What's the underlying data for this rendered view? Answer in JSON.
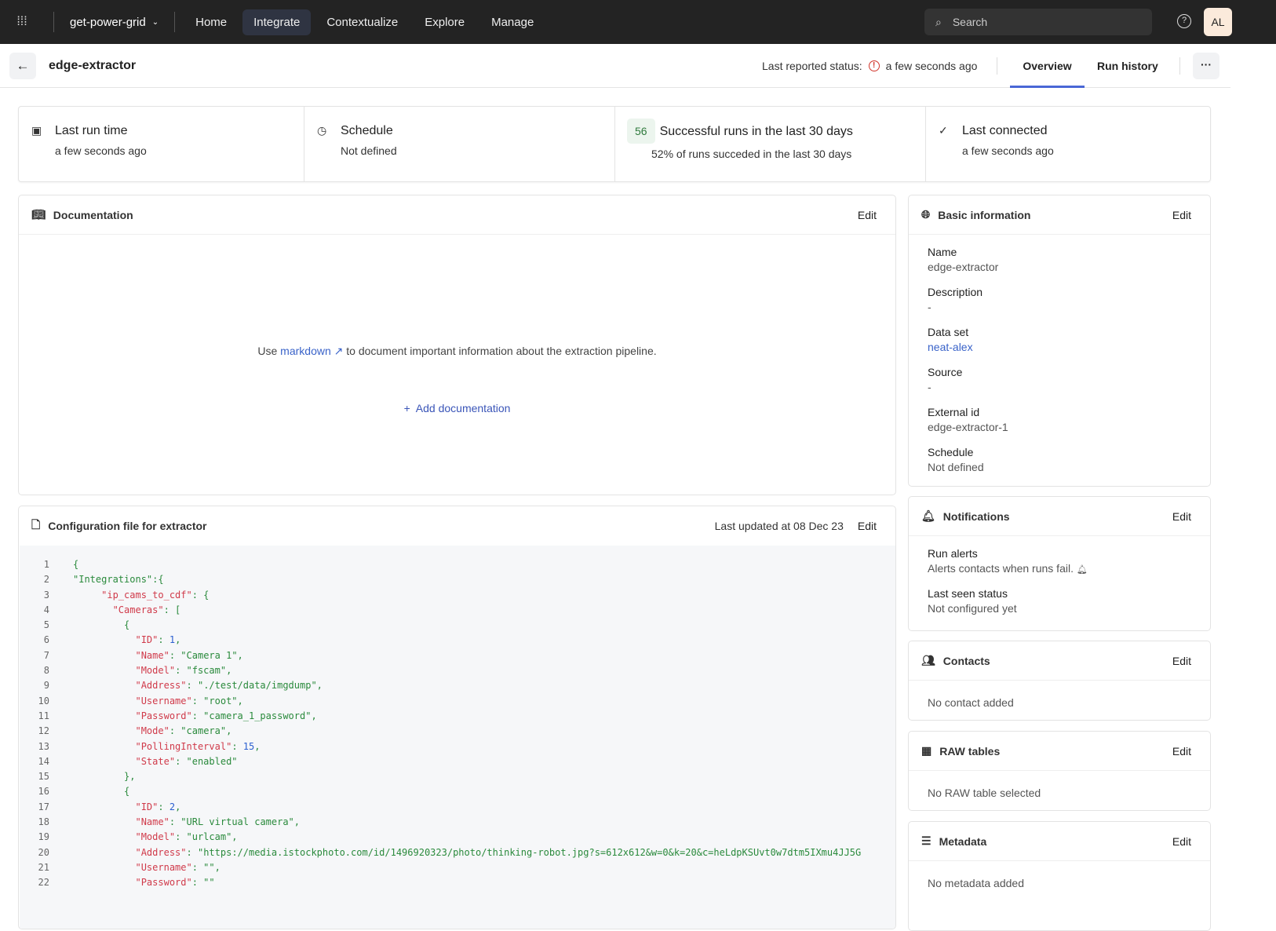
{
  "topbar": {
    "project": "get-power-grid",
    "nav": [
      "Home",
      "Integrate",
      "Contextualize",
      "Explore",
      "Manage"
    ],
    "active": "Integrate",
    "search_placeholder": "Search",
    "avatar": "AL"
  },
  "header": {
    "title": "edge-extractor",
    "status_label": "Last reported status:",
    "status_value": "a few seconds ago",
    "tabs": [
      "Overview",
      "Run history"
    ],
    "active_tab": "Overview"
  },
  "stats": [
    {
      "title": "Last run time",
      "sub": "a few seconds ago"
    },
    {
      "title": "Schedule",
      "sub": "Not defined"
    },
    {
      "badge": "56",
      "title": "Successful runs in the last 30 days",
      "sub": "52% of runs succeded in the last 30 days"
    },
    {
      "title": "Last connected",
      "sub": "a few seconds ago"
    }
  ],
  "documentation": {
    "title": "Documentation",
    "edit": "Edit",
    "text_before": "Use",
    "link": "markdown",
    "text_after": "to document important information about the extraction pipeline.",
    "add": "Add documentation"
  },
  "config": {
    "title": "Configuration file for extractor",
    "updated": "Last updated at 08 Dec 23",
    "edit": "Edit",
    "lines": [
      [
        [
          "{",
          "punc"
        ]
      ],
      [
        [
          "\"Integrations\":{",
          "str"
        ]
      ],
      [
        [
          "     ",
          ""
        ],
        [
          "\"ip_cams_to_cdf\"",
          "key"
        ],
        [
          ": {",
          "punc"
        ]
      ],
      [
        [
          "       ",
          ""
        ],
        [
          "\"Cameras\"",
          "key"
        ],
        [
          ": [",
          "punc"
        ]
      ],
      [
        [
          "         {",
          "punc"
        ]
      ],
      [
        [
          "           ",
          ""
        ],
        [
          "\"ID\"",
          "key"
        ],
        [
          ": ",
          "punc"
        ],
        [
          "1",
          "num"
        ],
        [
          ",",
          "punc"
        ]
      ],
      [
        [
          "           ",
          ""
        ],
        [
          "\"Name\"",
          "key"
        ],
        [
          ": \"Camera 1\",",
          "str"
        ]
      ],
      [
        [
          "           ",
          ""
        ],
        [
          "\"Model\"",
          "key"
        ],
        [
          ": \"fscam\",",
          "str"
        ]
      ],
      [
        [
          "           ",
          ""
        ],
        [
          "\"Address\"",
          "key"
        ],
        [
          ": \"./test/data/imgdump\",",
          "str"
        ]
      ],
      [
        [
          "           ",
          ""
        ],
        [
          "\"Username\"",
          "key"
        ],
        [
          ": \"root\",",
          "str"
        ]
      ],
      [
        [
          "           ",
          ""
        ],
        [
          "\"Password\"",
          "key"
        ],
        [
          ": \"camera_1_password\",",
          "str"
        ]
      ],
      [
        [
          "           ",
          ""
        ],
        [
          "\"Mode\"",
          "key"
        ],
        [
          ": \"camera\",",
          "str"
        ]
      ],
      [
        [
          "           ",
          ""
        ],
        [
          "\"PollingInterval\"",
          "key"
        ],
        [
          ": ",
          "punc"
        ],
        [
          "15",
          "num"
        ],
        [
          ",",
          "punc"
        ]
      ],
      [
        [
          "           ",
          ""
        ],
        [
          "\"State\"",
          "key"
        ],
        [
          ": \"enabled\"",
          "str"
        ]
      ],
      [
        [
          "         },",
          "punc"
        ]
      ],
      [
        [
          "         {",
          "punc"
        ]
      ],
      [
        [
          "           ",
          ""
        ],
        [
          "\"ID\"",
          "key"
        ],
        [
          ": ",
          "punc"
        ],
        [
          "2",
          "num"
        ],
        [
          ",",
          "punc"
        ]
      ],
      [
        [
          "           ",
          ""
        ],
        [
          "\"Name\"",
          "key"
        ],
        [
          ": \"URL virtual camera\",",
          "str"
        ]
      ],
      [
        [
          "           ",
          ""
        ],
        [
          "\"Model\"",
          "key"
        ],
        [
          ": \"urlcam\",",
          "str"
        ]
      ],
      [
        [
          "           ",
          ""
        ],
        [
          "\"Address\"",
          "key"
        ],
        [
          ": \"https://media.istockphoto.com/id/1496920323/photo/thinking-robot.jpg?s=612x612&w=0&k=20&c=heLdpKSUvt0w7dtm5IXmu4JJ5G",
          "str"
        ]
      ],
      [
        [
          "           ",
          ""
        ],
        [
          "\"Username\"",
          "key"
        ],
        [
          ": \"\",",
          "str"
        ]
      ],
      [
        [
          "           ",
          ""
        ],
        [
          "\"Password\"",
          "key"
        ],
        [
          ": \"\"",
          "str"
        ]
      ]
    ]
  },
  "basic": {
    "title": "Basic information",
    "edit": "Edit",
    "fields": [
      {
        "label": "Name",
        "value": "edge-extractor"
      },
      {
        "label": "Description",
        "value": "-"
      },
      {
        "label": "Data set",
        "value": "neat-alex",
        "link": true
      },
      {
        "label": "Source",
        "value": "-"
      },
      {
        "label": "External id",
        "value": "edge-extractor-1"
      },
      {
        "label": "Schedule",
        "value": "Not defined"
      }
    ]
  },
  "notifications": {
    "title": "Notifications",
    "edit": "Edit",
    "fields": [
      {
        "label": "Run alerts",
        "value": "Alerts contacts when runs fail."
      },
      {
        "label": "Last seen status",
        "value": "Not configured yet"
      }
    ]
  },
  "contacts": {
    "title": "Contacts",
    "edit": "Edit",
    "empty": "No contact added"
  },
  "raw": {
    "title": "RAW tables",
    "edit": "Edit",
    "empty": "No RAW table selected"
  },
  "metadata": {
    "title": "Metadata",
    "edit": "Edit",
    "empty": "No metadata added"
  }
}
